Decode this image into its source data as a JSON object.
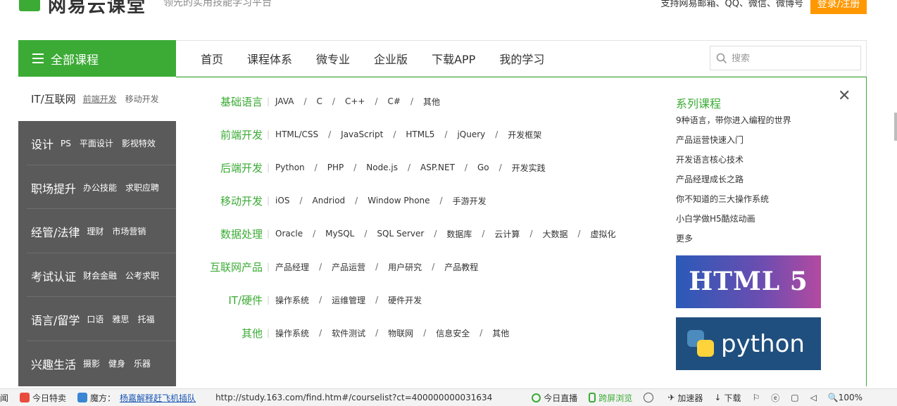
{
  "header": {
    "logo_text": "网易云课堂",
    "slogan": "领先的实用技能学习平台",
    "login_hint": "支持网易邮箱、QQ、微信、微博号",
    "login_button": "登录/注册"
  },
  "nav": {
    "all_courses": "全部课程",
    "links": [
      "首页",
      "课程体系",
      "微专业",
      "企业版",
      "下载APP",
      "我的学习"
    ],
    "search_placeholder": "搜索"
  },
  "sidebar": {
    "categories": [
      {
        "main": "IT/互联网",
        "subs": [
          "前端开发",
          "移动开发"
        ]
      },
      {
        "main": "设计",
        "subs": [
          "PS",
          "平面设计",
          "影视特效"
        ]
      },
      {
        "main": "职场提升",
        "subs": [
          "办公技能",
          "求职应聘"
        ]
      },
      {
        "main": "经管/法律",
        "subs": [
          "理财",
          "市场营销"
        ]
      },
      {
        "main": "考试认证",
        "subs": [
          "财会金融",
          "公考求职"
        ]
      },
      {
        "main": "语言/留学",
        "subs": [
          "口语",
          "雅思",
          "托福"
        ]
      },
      {
        "main": "兴趣生活",
        "subs": [
          "摄影",
          "健身",
          "乐器"
        ]
      }
    ]
  },
  "panel": {
    "rows": [
      {
        "title": "基础语言",
        "items": [
          "JAVA",
          "C",
          "C++",
          "C#",
          "其他"
        ]
      },
      {
        "title": "前端开发",
        "items": [
          "HTML/CSS",
          "JavaScript",
          "HTML5",
          "jQuery",
          "开发框架"
        ]
      },
      {
        "title": "后端开发",
        "items": [
          "Python",
          "PHP",
          "Node.js",
          "ASP.NET",
          "Go",
          "开发实践"
        ]
      },
      {
        "title": "移动开发",
        "items": [
          "iOS",
          "Andriod",
          "Window Phone",
          "手游开发"
        ]
      },
      {
        "title": "数据处理",
        "items": [
          "Oracle",
          "MySQL",
          "SQL Server",
          "数据库",
          "云计算",
          "大数据",
          "虚拟化"
        ]
      },
      {
        "title": "互联网产品",
        "items": [
          "产品经理",
          "产品运营",
          "用户研究",
          "产品教程"
        ]
      },
      {
        "title": "IT/硬件",
        "items": [
          "操作系统",
          "运维管理",
          "硬件开发"
        ]
      },
      {
        "title": "其他",
        "items": [
          "操作系统",
          "软件测试",
          "物联网",
          "信息安全",
          "其他"
        ]
      }
    ],
    "series_title": "系列课程",
    "series": [
      "9种语言，带你进入编程的世界",
      "产品运营快速入门",
      "开发语言核心技术",
      "产品经理成长之路",
      "你不知道的三大操作系统",
      "小白学做H5酷炫动画",
      "更多"
    ],
    "close": "✕",
    "promo_html": "HTML 5",
    "promo_python": "python"
  },
  "statusbar": {
    "left_cut": "闻",
    "today_deal": "今日特卖",
    "magic_label": "魔方：",
    "magic_link": "杨嘉解释赶飞机插队",
    "url": "http://study.163.com/find.htm#/courselist?ct=400000000031634",
    "live": "今日直播",
    "cross_screen": "跨屏浏览",
    "accelerator": "加速器",
    "download": "下载",
    "zoom": "100%"
  },
  "colors": {
    "brand_green": "#3bab35",
    "sidebar_bg": "#5a5a5a",
    "orange": "#ff9800"
  }
}
